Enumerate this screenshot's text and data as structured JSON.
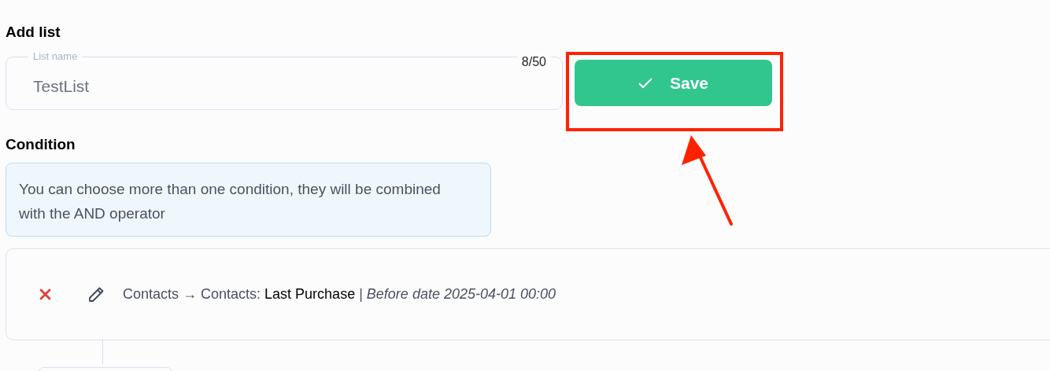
{
  "title": "Add list",
  "list_name": {
    "label": "List name",
    "value": "TestList",
    "counter": "8/50"
  },
  "save_button": {
    "label": "Save"
  },
  "condition": {
    "heading": "Condition",
    "info": "You can choose more than one condition, they will be combined with the AND operator",
    "items": [
      {
        "text": "Contacts → Contacts: **Last Purchase** | *Before date 2025-04-01 00:00*"
      }
    ]
  }
}
